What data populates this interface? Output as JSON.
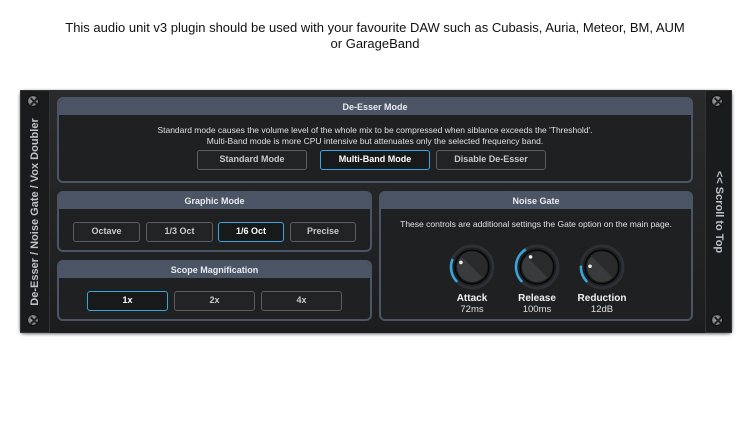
{
  "caption": {
    "line1": "This audio unit v3 plugin should be used with your favourite DAW such as Cubasis, Auria, Meteor, BM, AUM",
    "line2": "or GarageBand"
  },
  "left_strip": "De-Esser / Noise Gate / Vox Doubler",
  "right_strip": "<< Scroll to Top",
  "deesser": {
    "title": "De-Esser Mode",
    "desc1": "Standard mode causes the volume level of the whole mix to be compressed when siblance exceeds the 'Threshold'.",
    "desc2": "Multi-Band mode is more CPU intensive but attenuates only the selected frequency band.",
    "buttons": [
      "Standard Mode",
      "Multi-Band Mode",
      "Disable De-Esser"
    ],
    "selected": "Multi-Band Mode"
  },
  "graphic": {
    "title": "Graphic Mode",
    "buttons": [
      "Octave",
      "1/3 Oct",
      "1/6 Oct",
      "Precise"
    ],
    "selected": "1/6 Oct"
  },
  "scope": {
    "title": "Scope Magnification",
    "buttons": [
      "1x",
      "2x",
      "4x"
    ],
    "selected": "1x"
  },
  "gate": {
    "title": "Noise Gate",
    "desc": "These controls are additional settings the Gate option on the main page.",
    "knobs": [
      {
        "label": "Attack",
        "value": "72ms",
        "level": 0.25
      },
      {
        "label": "Release",
        "value": "100ms",
        "level": 0.38
      },
      {
        "label": "Reduction",
        "value": "12dB",
        "level": 0.18
      }
    ]
  },
  "colors": {
    "accent": "#3aa6dd",
    "header": "#4b5565"
  }
}
